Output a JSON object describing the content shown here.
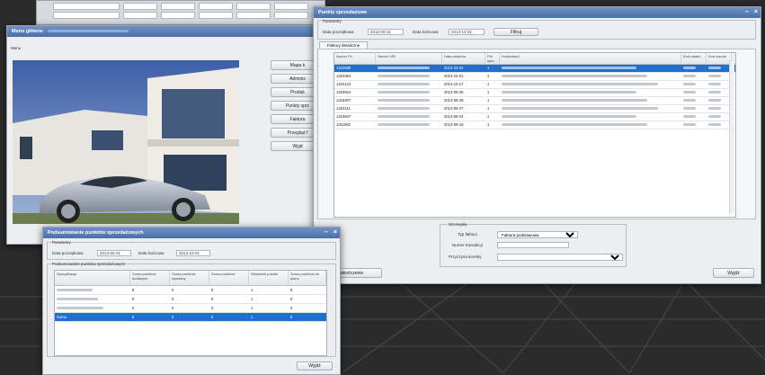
{
  "main_window": {
    "title": "Menu główne",
    "menu_label": "Menu",
    "buttons": [
      "Mapa k",
      "Adminis",
      "Produk",
      "Punkty sprz",
      "Faktura",
      "Przegląd f",
      "Wyjd"
    ]
  },
  "points_window": {
    "title": "Punkty sprzedażowe",
    "params_group": "Parametry",
    "date_from_label": "Data początkowa",
    "date_from": "2013-06-01",
    "date_to_label": "Data końcowa",
    "date_to": "2013-10-01",
    "filter_button": "Filtruj",
    "tab_label": "Faktury detaliczne",
    "columns": [
      "Numer FV",
      "Numer URI",
      "Data dodania",
      "Pkt sprz.",
      "Kontrahent",
      "Kod rabatu",
      "Kod zwrotu"
    ],
    "rows": [
      {
        "num": "1322589",
        "date": "2013-10-02",
        "pkt": "1",
        "selected": true
      },
      {
        "num": "1322364",
        "date": "2013-10-01",
        "pkt": "1",
        "selected": false
      },
      {
        "num": "1322123",
        "date": "2013-10-17",
        "pkt": "1",
        "selected": false
      },
      {
        "num": "1319924",
        "date": "2013-09-30",
        "pkt": "1",
        "selected": false
      },
      {
        "num": "1318407",
        "date": "2013-09-28",
        "pkt": "1",
        "selected": false
      },
      {
        "num": "1322111",
        "date": "2013-09-27",
        "pkt": "1",
        "selected": false
      },
      {
        "num": "1316847",
        "date": "2013-09-24",
        "pkt": "1",
        "selected": false
      },
      {
        "num": "1311962",
        "date": "2013-09-18",
        "pkt": "1",
        "selected": false
      }
    ],
    "summary_group": "Szczegóły",
    "type_label": "Typ faktury",
    "type_value": "Faktura podstawowa",
    "invoice_no_label": "Numer transakcji",
    "trans_label": "Przyczyna korekty",
    "close_button": "Zakończenie",
    "exit_button": "Wyjdź"
  },
  "summary_window": {
    "title": "Podsumowanie punktów sprzedażowych",
    "params_group": "Parametry",
    "date_from_label": "Data początkowa",
    "date_from": "2013-06-01",
    "date_to_label": "Data końcowa",
    "date_to": "2013-10-01",
    "grid_group": "Podsumowanie punktów sprzedażowych",
    "columns": [
      "Specyfikacje",
      "Suma punktów dodanych",
      "Suma punktów wymiany",
      "Suma punktów",
      "Wskaźnik punktu",
      "Suma punktów do planu"
    ],
    "rows": [
      {
        "name": "",
        "v1": "8",
        "v2": "0",
        "v3": "8",
        "v4": "1",
        "v5": "8",
        "selected": false
      },
      {
        "name": "",
        "v1": "0",
        "v2": "0",
        "v3": "0",
        "v4": "1",
        "v5": "0",
        "selected": false
      },
      {
        "name": "",
        "v1": "0",
        "v2": "0",
        "v3": "0",
        "v4": "1",
        "v5": "0",
        "selected": false
      },
      {
        "name": "Suma",
        "v1": "8",
        "v2": "0",
        "v3": "8",
        "v4": "1",
        "v5": "8",
        "selected": true
      }
    ],
    "exit_button": "Wyjdź"
  }
}
